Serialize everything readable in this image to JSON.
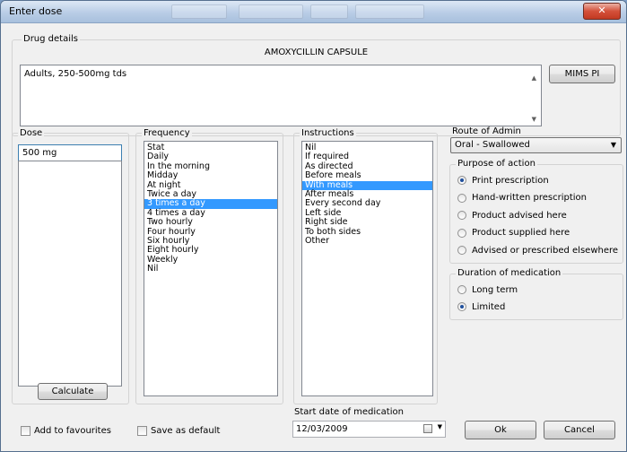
{
  "window": {
    "title": "Enter dose",
    "close_glyph": "✕"
  },
  "drug_details": {
    "legend": "Drug details",
    "drug_name": "AMOXYCILLIN CAPSULE",
    "dose_text": "Adults, 250-500mg tds",
    "mims_button": "MIMS PI"
  },
  "dose": {
    "label": "Dose",
    "value": "500 mg",
    "calculate_button": "Calculate"
  },
  "frequency": {
    "label": "Frequency",
    "items": [
      "Stat",
      "Daily",
      "In the morning",
      "Midday",
      "At night",
      "Twice a day",
      "3 times a day",
      "4 times a day",
      "Two hourly",
      "Four hourly",
      "Six hourly",
      "Eight hourly",
      "Weekly",
      "Nil"
    ],
    "selected": "3 times a day"
  },
  "instructions": {
    "label": "Instructions",
    "items": [
      "Nil",
      "If required",
      "As directed",
      "Before meals",
      "With meals",
      "After meals",
      "Every second day",
      "Left side",
      "Right side",
      "To both sides",
      "Other"
    ],
    "selected": "With meals"
  },
  "route": {
    "label": "Route of Admin",
    "value": "Oral - Swallowed"
  },
  "purpose": {
    "legend": "Purpose of action",
    "options": [
      "Print prescription",
      "Hand-written prescription",
      "Product advised here",
      "Product supplied here",
      "Advised or prescribed elsewhere"
    ],
    "selected": "Print prescription"
  },
  "duration": {
    "legend": "Duration of medication",
    "options": [
      "Long term",
      "Limited"
    ],
    "selected": "Limited"
  },
  "footer": {
    "add_favourites": "Add to favourites",
    "save_default": "Save as default",
    "start_date_label": "Start date of medication",
    "start_date": "12/03/2009",
    "ok_button": "Ok",
    "cancel_button": "Cancel"
  },
  "colors": {
    "selection": "#3399ff",
    "title_gradient_top": "#dde8f5",
    "close_button": "#c23a22"
  }
}
